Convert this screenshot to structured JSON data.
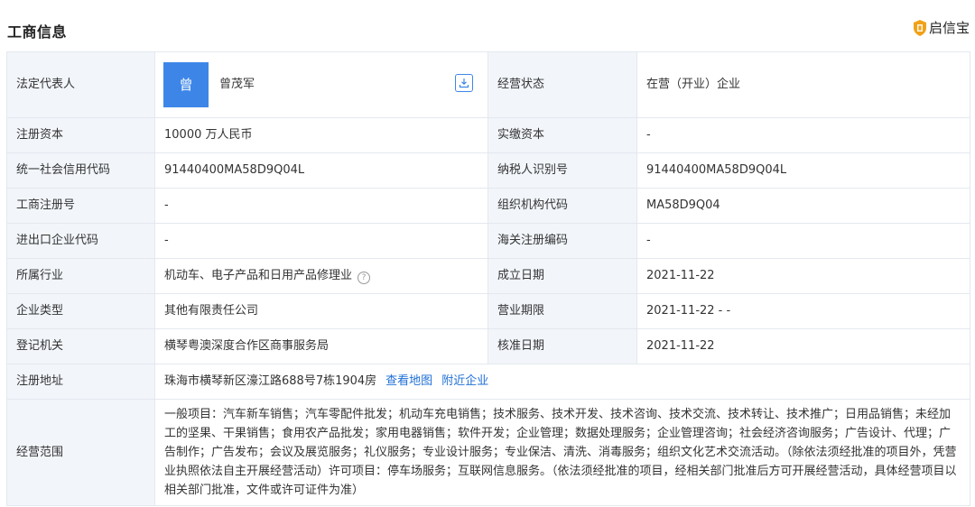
{
  "header": {
    "title": "工商信息",
    "brand": "启信宝"
  },
  "rows": [
    {
      "label_left": "法定代表人",
      "value_left": "曾茂军",
      "label_right": "经营状态",
      "value_right": "在营（开业）企业"
    },
    {
      "label_left": "注册资本",
      "value_left": "10000 万人民币",
      "label_right": "实缴资本",
      "value_right": "-"
    },
    {
      "label_left": "统一社会信用代码",
      "value_left": "91440400MA58D9Q04L",
      "label_right": "纳税人识别号",
      "value_right": "91440400MA58D9Q04L"
    },
    {
      "label_left": "工商注册号",
      "value_left": "-",
      "label_right": "组织机构代码",
      "value_right": "MA58D9Q04"
    },
    {
      "label_left": "进出口企业代码",
      "value_left": "-",
      "label_right": "海关注册编码",
      "value_right": "-"
    },
    {
      "label_left": "所属行业",
      "value_left": "机动车、电子产品和日用产品修理业",
      "label_right": "成立日期",
      "value_right": "2021-11-22"
    },
    {
      "label_left": "企业类型",
      "value_left": "其他有限责任公司",
      "label_right": "营业期限",
      "value_right": "2021-11-22 - -"
    },
    {
      "label_left": "登记机关",
      "value_left": "横琴粤澳深度合作区商事服务局",
      "label_right": "核准日期",
      "value_right": "2021-11-22"
    }
  ],
  "rep": {
    "avatar_char": "曾"
  },
  "address": {
    "label": "注册地址",
    "value": "珠海市横琴新区濠江路688号7栋1904房",
    "map_link": "查看地图",
    "nearby_link": "附近企业"
  },
  "scope": {
    "label": "经营范围",
    "value": "一般项目：汽车新车销售；汽车零配件批发；机动车充电销售；技术服务、技术开发、技术咨询、技术交流、技术转让、技术推广；日用品销售；未经加工的坚果、干果销售；食用农产品批发；家用电器销售；软件开发；企业管理；数据处理服务；企业管理咨询；社会经济咨询服务；广告设计、代理；广告制作；广告发布；会议及展览服务；礼仪服务；专业设计服务；专业保洁、清洗、消毒服务；组织文化艺术交流活动。（除依法须经批准的项目外，凭营业执照依法自主开展经营活动）许可项目：停车场服务；互联网信息服务。（依法须经批准的项目，经相关部门批准后方可开展经营活动，具体经营项目以相关部门批准，文件或许可证件为准）"
  },
  "icons": {
    "download": "download-icon",
    "help": "question-circle-icon",
    "brand": "shield-logo-icon"
  },
  "colors": {
    "accent": "#3d86e8",
    "link": "#1f6fd6",
    "label_bg": "#f2f6fb",
    "border": "#e4e8ee"
  }
}
